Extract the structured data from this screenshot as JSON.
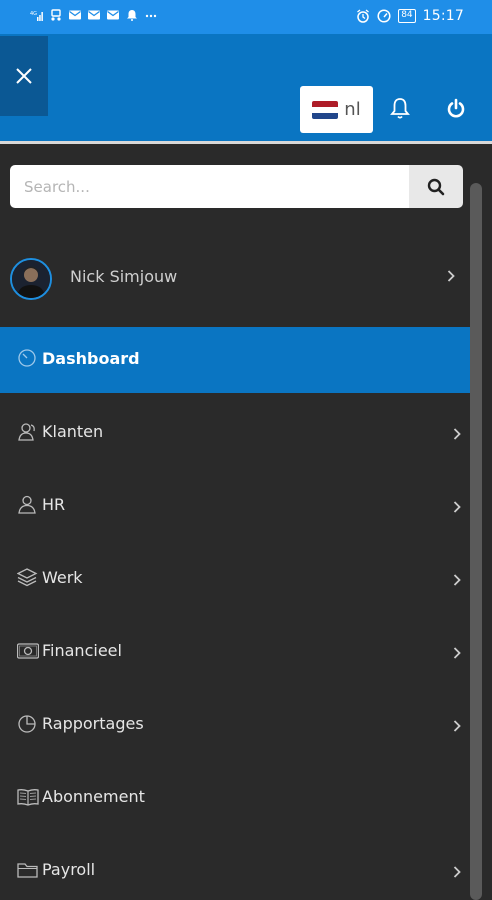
{
  "status_bar": {
    "left_icons": [
      "signal-icon",
      "usb-icon",
      "mail-icon",
      "mail-icon",
      "mail-icon",
      "notification-icon",
      "more-icon"
    ],
    "battery": "84",
    "time": "15:17"
  },
  "header": {
    "language_code": "nl",
    "flag_colors": [
      "#ae1c28",
      "#ffffff",
      "#21468b"
    ],
    "accent_color": "#0a75c2"
  },
  "search": {
    "placeholder": "Search...",
    "value": ""
  },
  "user": {
    "name": "Nick Simjouw"
  },
  "menu": [
    {
      "label": "Dashboard",
      "icon": "dashboard-gauge-icon",
      "active": true,
      "has_chevron": false
    },
    {
      "label": "Klanten",
      "icon": "clients-icon",
      "active": false,
      "has_chevron": true
    },
    {
      "label": "HR",
      "icon": "person-icon",
      "active": false,
      "has_chevron": true
    },
    {
      "label": "Werk",
      "icon": "layers-icon",
      "active": false,
      "has_chevron": true
    },
    {
      "label": "Financieel",
      "icon": "money-icon",
      "active": false,
      "has_chevron": true
    },
    {
      "label": "Rapportages",
      "icon": "pie-chart-icon",
      "active": false,
      "has_chevron": true
    },
    {
      "label": "Abonnement",
      "icon": "book-icon",
      "active": false,
      "has_chevron": false
    },
    {
      "label": "Payroll",
      "icon": "folder-icon",
      "active": false,
      "has_chevron": true
    }
  ]
}
